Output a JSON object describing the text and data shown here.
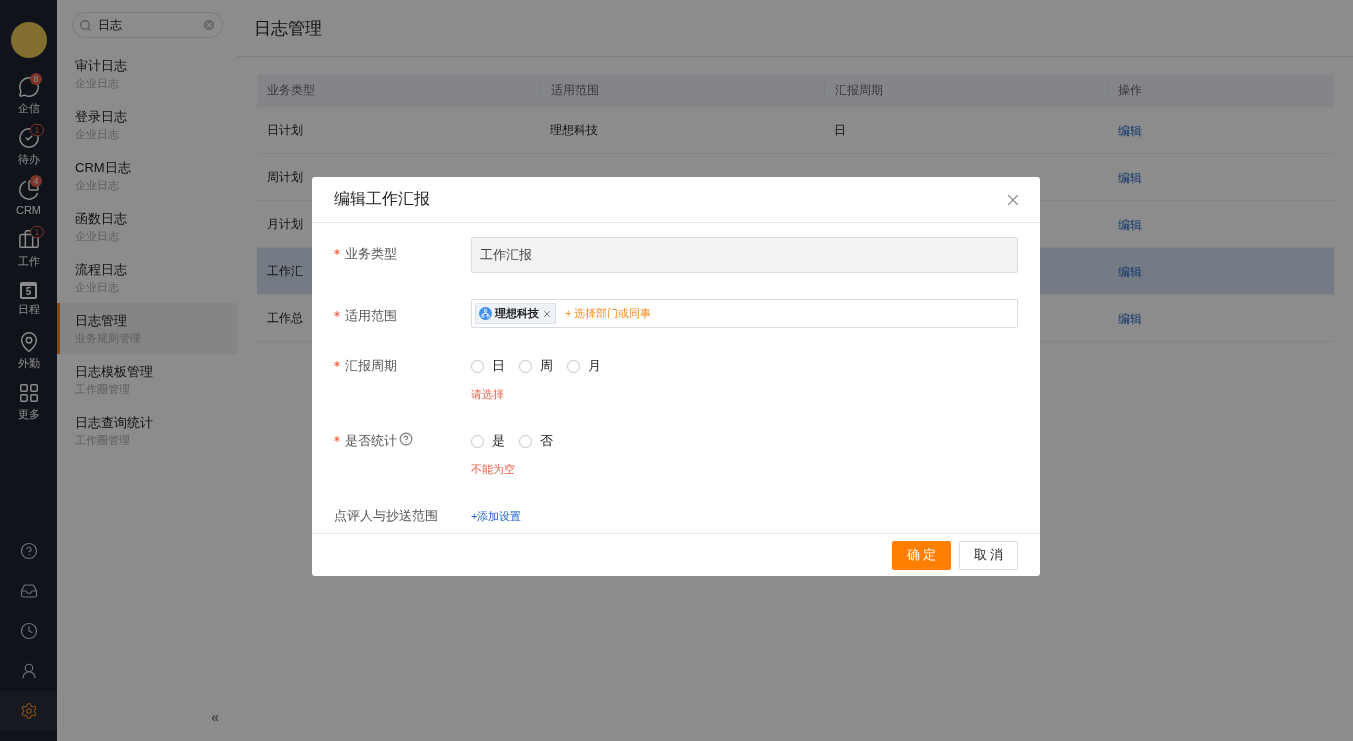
{
  "sidebar": {
    "nav": [
      {
        "label": "企信",
        "badge": "8",
        "outlined": false
      },
      {
        "label": "待办",
        "badge": "1",
        "outlined": true
      },
      {
        "label": "CRM",
        "badge": "4",
        "outlined": false
      },
      {
        "label": "工作",
        "badge": "1",
        "outlined": true
      },
      {
        "label": "日程",
        "day": "5"
      },
      {
        "label": "外勤"
      },
      {
        "label": "更多"
      }
    ],
    "tools": [
      {
        "selected": false
      },
      {
        "selected": false
      },
      {
        "selected": false
      },
      {
        "selected": false
      },
      {
        "selected": true
      }
    ]
  },
  "search": {
    "value": "日志"
  },
  "menu": [
    {
      "title": "审计日志",
      "subtitle": "企业日志",
      "selected": false
    },
    {
      "title": "登录日志",
      "subtitle": "企业日志",
      "selected": false
    },
    {
      "title": "CRM日志",
      "subtitle": "企业日志",
      "selected": false
    },
    {
      "title": "函数日志",
      "subtitle": "企业日志",
      "selected": false
    },
    {
      "title": "流程日志",
      "subtitle": "企业日志",
      "selected": false
    },
    {
      "title": "日志管理",
      "subtitle": "业务规则管理",
      "selected": true
    },
    {
      "title": "日志模板管理",
      "subtitle": "工作圈管理",
      "selected": false
    },
    {
      "title": "日志查询统计",
      "subtitle": "工作圈管理",
      "selected": false
    }
  ],
  "collapse": "«",
  "page_title": "日志管理",
  "table": {
    "columns": [
      "业务类型",
      "适用范围",
      "汇报周期",
      "操作"
    ],
    "rows": [
      {
        "type": "日计划",
        "scope": "理想科技",
        "period": "日",
        "action": "编辑",
        "selected": false
      },
      {
        "type": "周计划",
        "action": "编辑",
        "selected": false
      },
      {
        "type": "月计划",
        "action": "编辑",
        "selected": false
      },
      {
        "type": "工作汇",
        "action": "编辑",
        "selected": true
      },
      {
        "type": "工作总",
        "action": "编辑",
        "selected": false
      }
    ]
  },
  "dialog": {
    "title": "编辑工作汇报",
    "fields": [
      {
        "kind": "readonly",
        "label": "业务类型",
        "required": true,
        "value": "工作汇报"
      },
      {
        "kind": "tags",
        "label": "适用范围",
        "required": true,
        "tags": [
          "理想科技"
        ],
        "add": "+ 选择部门或同事"
      },
      {
        "kind": "radio",
        "label": "汇报周期",
        "required": true,
        "options": [
          {
            "label": "日",
            "selected": false
          },
          {
            "label": "周",
            "selected": false
          },
          {
            "label": "月",
            "selected": false
          }
        ],
        "error": "请选择"
      },
      {
        "kind": "radio",
        "label": "是否统计",
        "required": true,
        "help": true,
        "options": [
          {
            "label": "是",
            "selected": false
          },
          {
            "label": "否",
            "selected": false
          }
        ],
        "error": "不能为空"
      },
      {
        "kind": "link",
        "label": "点评人与抄送范围",
        "required": false,
        "link": "+添加设置"
      }
    ],
    "buttons": [
      {
        "label": "确 定",
        "primary": true
      },
      {
        "label": "取 消",
        "primary": false
      }
    ]
  }
}
